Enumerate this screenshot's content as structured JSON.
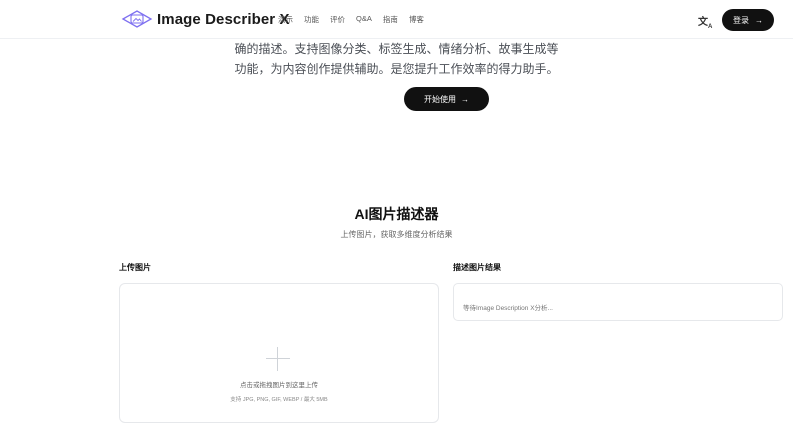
{
  "nav": {
    "brand": "Image Describer X",
    "links": [
      "演示",
      "功能",
      "评价",
      "Q&A",
      "指南",
      "博客"
    ],
    "lang_icon": "translate-icon",
    "login_label": "登录"
  },
  "hero": {
    "line1": "确的描述。支持图像分类、标签生成、情绪分析、故事生成等",
    "line2": "功能，为内容创作提供辅助。是您提升工作效率的得力助手。",
    "start_label": "开始使用"
  },
  "section": {
    "title": "AI图片描述器",
    "subtitle": "上传图片，获取多维度分析结果"
  },
  "upload": {
    "label": "上传图片",
    "hint": "点击或拖拽图片到这里上传",
    "formats": "支持 JPG, PNG, GIF, WEBP / 最大 5MB"
  },
  "result": {
    "label": "描述图片结果",
    "placeholder": "等待Image Description X分析..."
  }
}
